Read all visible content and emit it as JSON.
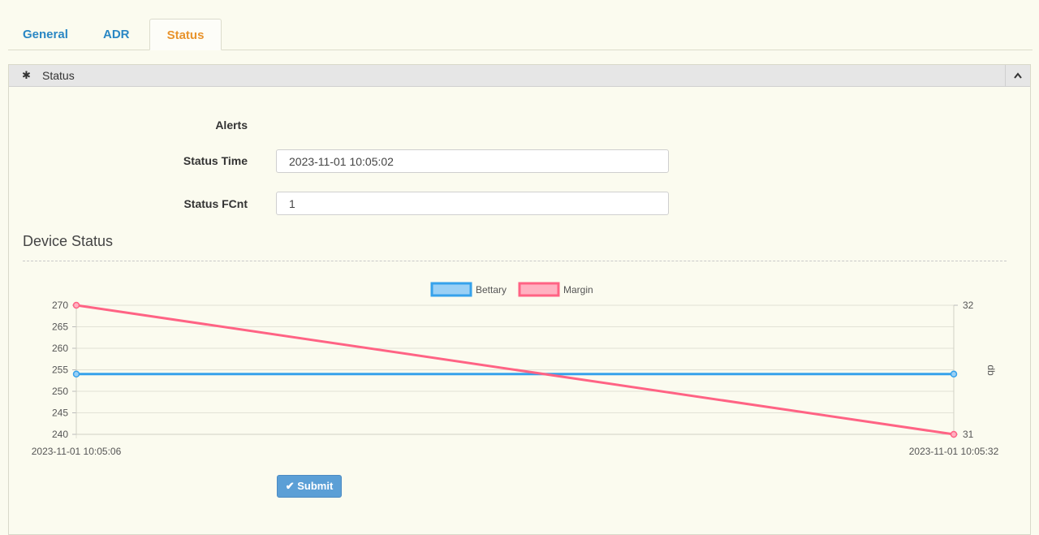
{
  "tabs": [
    {
      "label": "General",
      "active": false
    },
    {
      "label": "ADR",
      "active": false
    },
    {
      "label": "Status",
      "active": true
    }
  ],
  "panel": {
    "title": "Status",
    "icon": "gear-icon",
    "collapse_icon": "chevron-up-icon"
  },
  "form": {
    "alerts_label": "Alerts",
    "status_time_label": "Status Time",
    "status_time_value": "2023-11-01 10:05:02",
    "status_fcnt_label": "Status FCnt",
    "status_fcnt_value": "1"
  },
  "device_status": {
    "title": "Device Status"
  },
  "chart_data": {
    "type": "line",
    "x": [
      "2023-11-01 10:05:06",
      "2023-11-01 10:05:32"
    ],
    "series": [
      {
        "name": "Bettary",
        "values": [
          254,
          254
        ],
        "axis": "left",
        "color": "#36a2eb",
        "fill": "#9ad0f5"
      },
      {
        "name": "Margin",
        "values": [
          32,
          31
        ],
        "axis": "right",
        "color": "#ff6384",
        "fill": "#ffb1c1"
      }
    ],
    "y_left": {
      "ticks": [
        240,
        245,
        250,
        255,
        260,
        265,
        270
      ],
      "ylim": [
        240,
        270
      ]
    },
    "y_right": {
      "ticks": [
        31,
        32
      ],
      "ylim": [
        31,
        32
      ],
      "label": "db"
    },
    "legend": "top-center",
    "grid": true
  },
  "actions": {
    "submit_label": "Submit",
    "submit_icon": "check-icon"
  },
  "colors": {
    "accent": "#2a87c4",
    "active_tab": "#e8932c",
    "button": "#5b9fd6"
  }
}
